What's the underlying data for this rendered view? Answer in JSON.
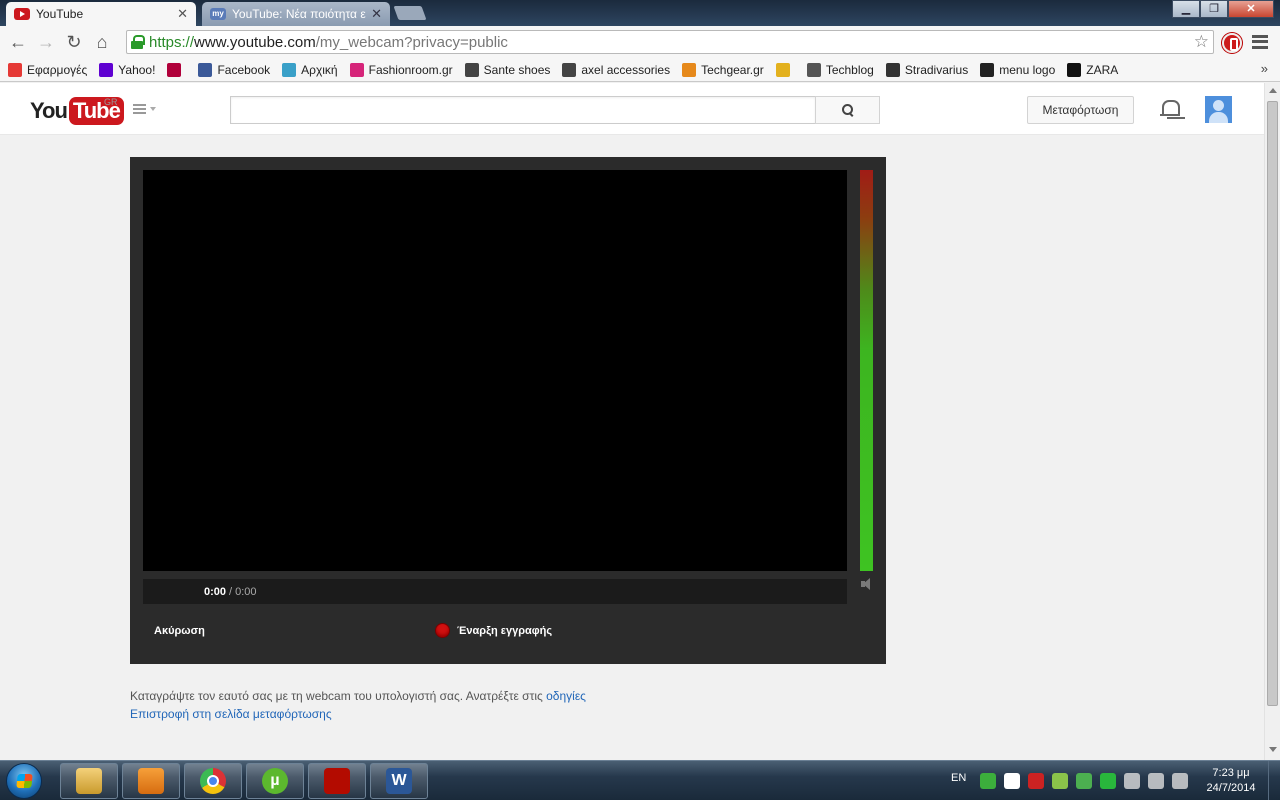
{
  "browser": {
    "tabs": [
      {
        "title": "YouTube",
        "active": true
      },
      {
        "title": "YouTube: Νέα ποιότητα ε",
        "active": false
      }
    ],
    "url": {
      "scheme": "https://",
      "host": "www.youtube.com",
      "path": "/my_webcam?privacy=public"
    },
    "bookmarks": [
      {
        "label": "Εφαρμογές",
        "icon": "apps-icon",
        "color": "#e53935"
      },
      {
        "label": "Yahoo!",
        "icon": "yahoo-icon",
        "color": "#5f01d1"
      },
      {
        "label": "",
        "icon": "bookmark-red-icon",
        "color": "#b0003a"
      },
      {
        "label": "Facebook",
        "icon": "facebook-icon",
        "color": "#3b5998"
      },
      {
        "label": "Αρχική",
        "icon": "page-icon",
        "color": "#3aa0c8"
      },
      {
        "label": "Fashionroom.gr",
        "icon": "heart-icon",
        "color": "#d6257a"
      },
      {
        "label": "Sante shoes",
        "icon": "shoe-icon",
        "color": "#444444"
      },
      {
        "label": "axel accessories",
        "icon": "heart-outline-icon",
        "color": "#444444"
      },
      {
        "label": "Techgear.gr",
        "icon": "fox-icon",
        "color": "#e6891b"
      },
      {
        "label": "",
        "icon": "bookmark-yellow-icon",
        "color": "#e3b11e"
      },
      {
        "label": "Techblog",
        "icon": "techblog-icon",
        "color": "#555555"
      },
      {
        "label": "Stradivarius",
        "icon": "stradivarius-icon",
        "color": "#333333"
      },
      {
        "label": "menu logo",
        "icon": "pb-icon",
        "color": "#222222"
      },
      {
        "label": "ZARA",
        "icon": "zara-icon",
        "color": "#111111"
      }
    ],
    "overflow": "»"
  },
  "masthead": {
    "logo_you": "You",
    "logo_tube": "Tube",
    "country": "GR",
    "search_placeholder": "",
    "upload_label": "Μεταφόρτωση"
  },
  "recorder": {
    "time_current": "0:00",
    "time_separator": "/",
    "time_total": "0:00",
    "cancel_label": "Ακύρωση",
    "record_label": "Έναρξη εγγραφής"
  },
  "footer": {
    "info_text": "Καταγράψτε τον εαυτό σας με τη webcam του υπολογιστή σας. Ανατρέξτε στις ",
    "info_link": "οδηγίες",
    "back_link": "Επιστροφή στη σελίδα μεταφόρτωσης"
  },
  "taskbar": {
    "apps": [
      {
        "name": "explorer-icon",
        "label": ""
      },
      {
        "name": "media-player-icon",
        "label": ""
      },
      {
        "name": "chrome-icon",
        "label": ""
      },
      {
        "name": "utorrent-icon",
        "label": "µ"
      },
      {
        "name": "acrobat-icon",
        "label": ""
      },
      {
        "name": "word-icon",
        "label": "W"
      }
    ],
    "language": "EN",
    "tray_colors": [
      "#3cae3c",
      "#ffffff",
      "#cc2222",
      "#8bc34a",
      "#4caf50",
      "#29b63c",
      "#dddddd",
      "#dddddd",
      "#dddddd"
    ],
    "time": "7:23 μμ",
    "date": "24/7/2014"
  }
}
